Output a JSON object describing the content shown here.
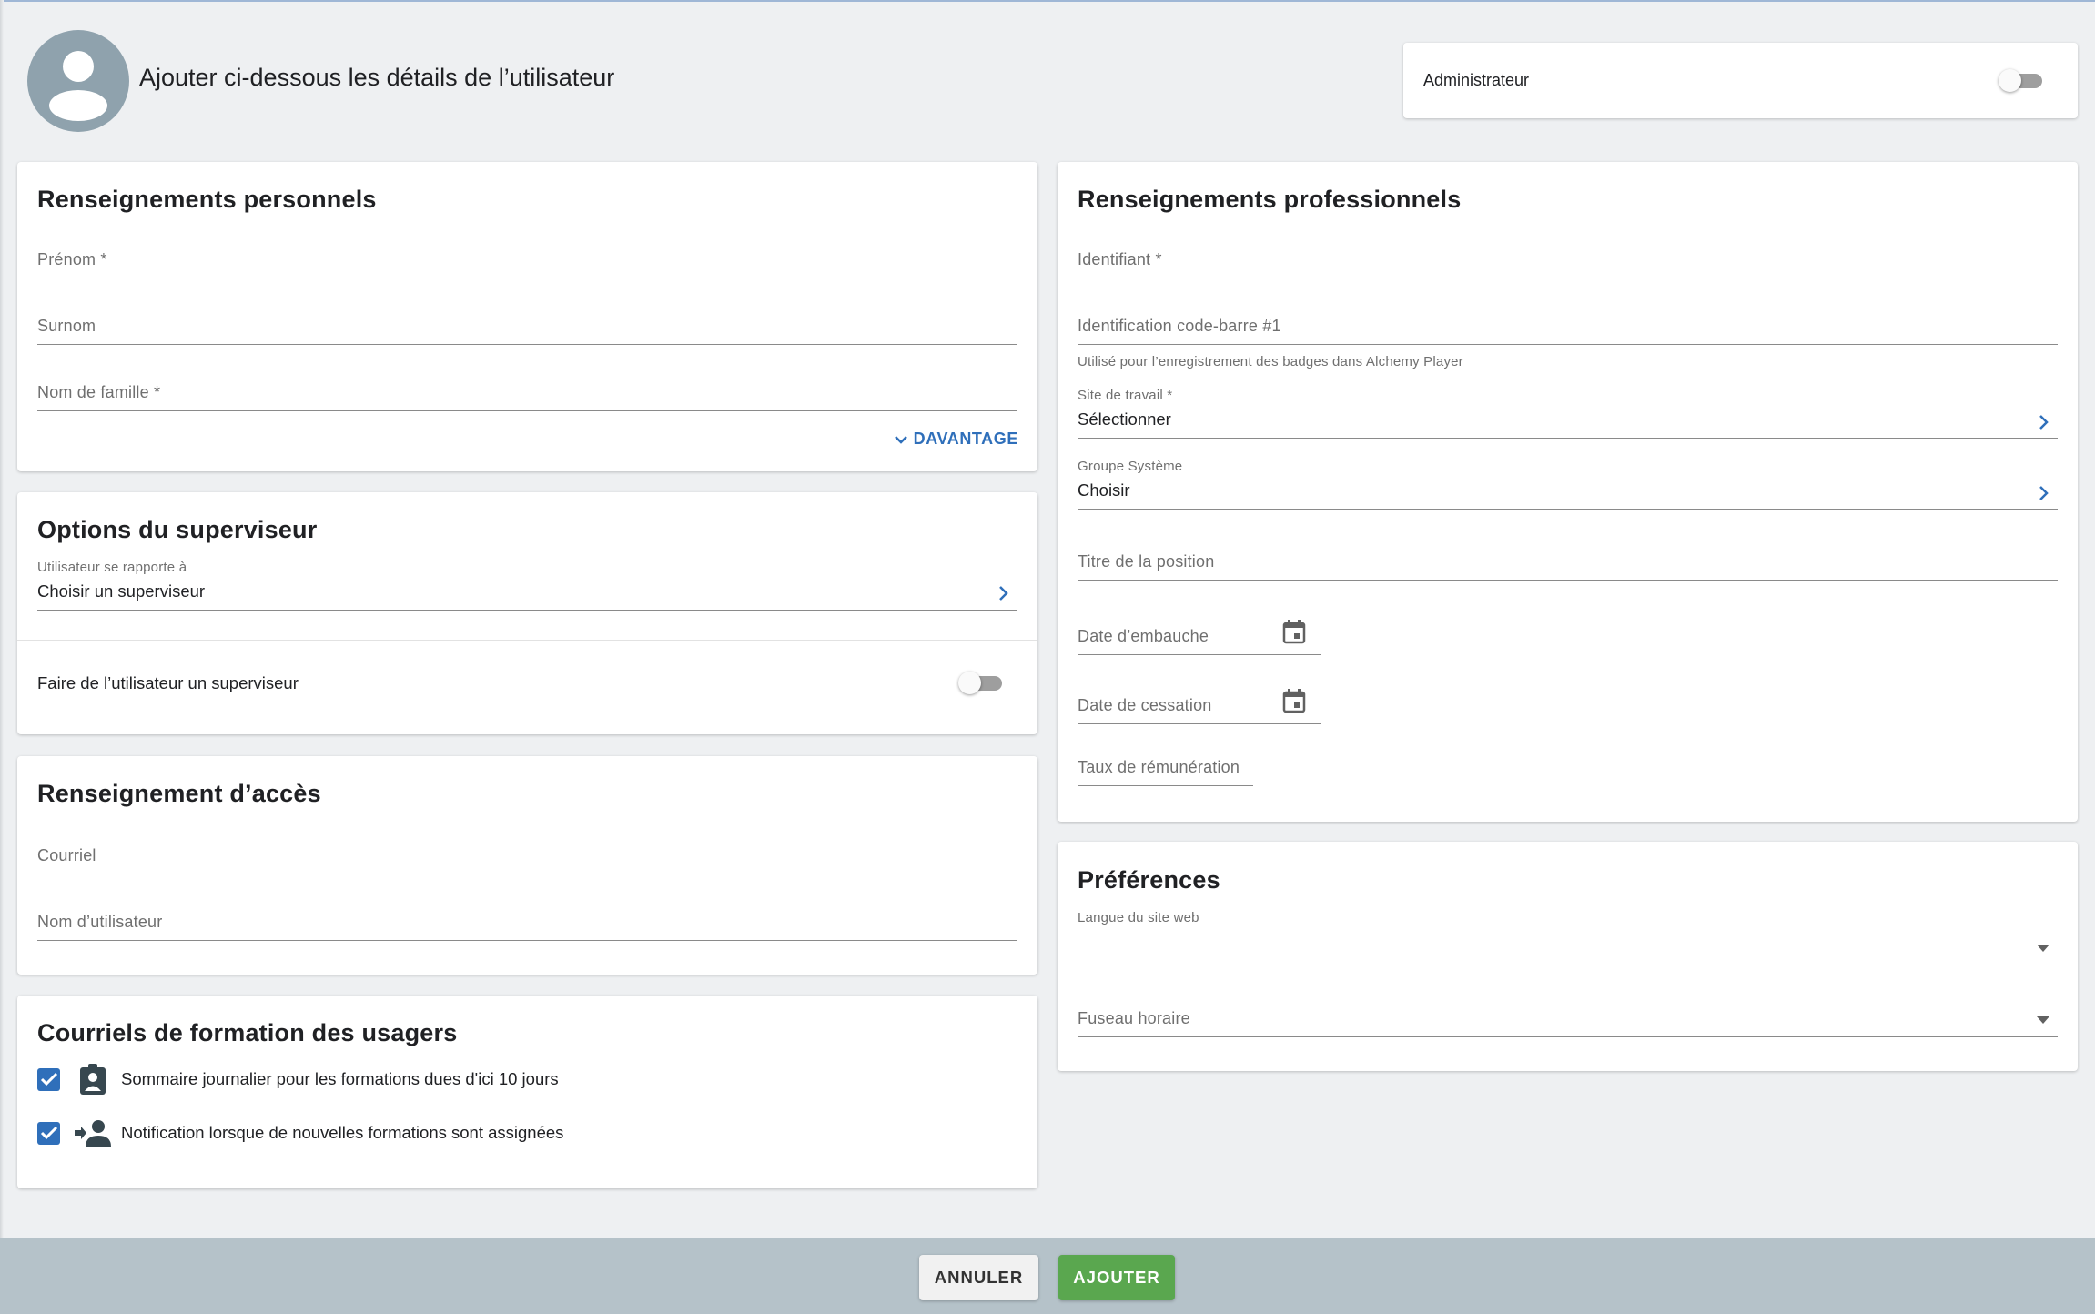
{
  "header": {
    "title": "Ajouter ci-dessous les détails de l’utilisateur",
    "admin_label": "Administrateur",
    "admin_enabled": false
  },
  "personal": {
    "title": "Renseignements personnels",
    "first_name_placeholder": "Prénom *",
    "nickname_placeholder": "Surnom",
    "last_name_placeholder": "Nom de famille *",
    "more_label": "DAVANTAGE"
  },
  "supervisor": {
    "title": "Options du superviseur",
    "reports_to_label": "Utilisateur se rapporte à",
    "reports_to_value": "Choisir un superviseur",
    "make_supervisor_label": "Faire de l’utilisateur un superviseur",
    "make_supervisor_enabled": false
  },
  "access": {
    "title": "Renseignement d’accès",
    "email_placeholder": "Courriel",
    "username_placeholder": "Nom d’utilisateur"
  },
  "training_emails": {
    "title": "Courriels de formation des usagers",
    "items": [
      {
        "label": "Sommaire journalier pour les formations dues d'ici 10 jours",
        "checked": true,
        "icon": "assignment-ind-icon"
      },
      {
        "label": "Notification lorsque de nouvelles formations sont assignées",
        "checked": true,
        "icon": "person-arrow-icon"
      }
    ]
  },
  "professional": {
    "title": "Renseignements professionnels",
    "identifier_placeholder": "Identifiant *",
    "barcode_placeholder": "Identification code-barre #1",
    "barcode_hint": "Utilisé pour l’enregistrement des badges dans Alchemy Player",
    "worksite_label": "Site de travail *",
    "worksite_value": "Sélectionner",
    "system_group_label": "Groupe Système",
    "system_group_value": "Choisir",
    "position_title_placeholder": "Titre de la position",
    "hire_date_placeholder": "Date d’embauche",
    "termination_date_placeholder": "Date de cessation",
    "pay_rate_placeholder": "Taux de rémunération"
  },
  "preferences": {
    "title": "Préférences",
    "language_label": "Langue du site web",
    "language_value": "",
    "timezone_placeholder": "Fuseau horaire"
  },
  "footer": {
    "cancel_label": "ANNULER",
    "add_label": "AJOUTER"
  },
  "colors": {
    "accent": "#2f6fba",
    "add_button": "#5aa74f",
    "footer_bg": "#b5c2c9",
    "page_bg": "#eef0f2"
  }
}
